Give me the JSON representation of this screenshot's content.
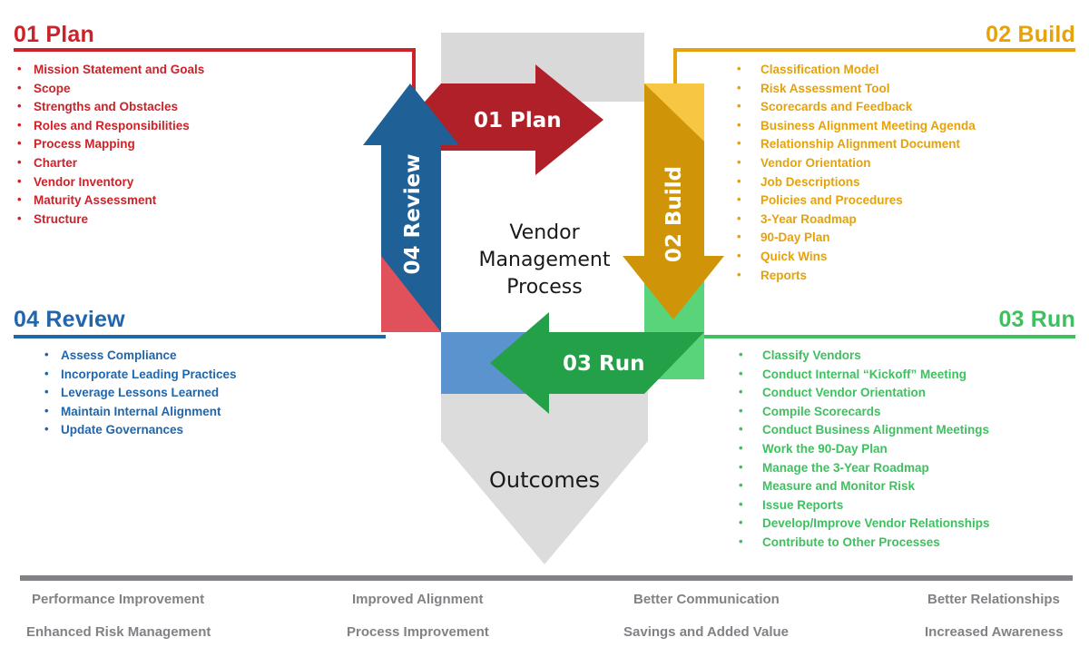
{
  "diagram": {
    "center": {
      "main_label": "Vendor\nManagement\nProcess",
      "main_label_line1": "Vendor",
      "main_label_line2": "Management",
      "main_label_line3": "Process",
      "outcomes_label": "Outcomes"
    },
    "arrows": [
      {
        "id": "plan",
        "label": "01 Plan",
        "direction": "right",
        "color": "#b02028",
        "accent": "#e0515b"
      },
      {
        "id": "build",
        "label": "02 Build",
        "direction": "down",
        "color": "#cf9408",
        "accent": "#f7c643"
      },
      {
        "id": "run",
        "label": "03 Run",
        "direction": "left",
        "color": "#24a148",
        "accent": "#5ad47a"
      },
      {
        "id": "review",
        "label": "04 Review",
        "direction": "up",
        "color": "#1f6096",
        "accent": "#5a93cd"
      }
    ]
  },
  "quadrants": [
    {
      "id": "plan",
      "title": "01 Plan",
      "color": "#cc2229",
      "items": [
        "Mission Statement and Goals",
        "Scope",
        "Strengths and Obstacles",
        "Roles and Responsibilities",
        "Process Mapping",
        "Charter",
        "Vendor Inventory",
        "Maturity Assessment",
        "Structure"
      ]
    },
    {
      "id": "build",
      "title": "02 Build",
      "color": "#e5a20a",
      "items": [
        "Classification Model",
        "Risk Assessment Tool",
        "Scorecards and Feedback",
        "Business Alignment Meeting Agenda",
        "Relationship Alignment Document",
        "Vendor Orientation",
        "Job Descriptions",
        "Policies and Procedures",
        "3-Year Roadmap",
        "90-Day Plan",
        "Quick Wins",
        "Reports"
      ]
    },
    {
      "id": "review",
      "title": "04 Review",
      "color": "#2166ab",
      "items": [
        "Assess Compliance",
        "Incorporate Leading Practices",
        "Leverage Lessons Learned",
        "Maintain Internal Alignment",
        "Update Governances"
      ]
    },
    {
      "id": "run",
      "title": "03 Run",
      "color": "#3fc060",
      "items": [
        "Classify Vendors",
        "Conduct Internal “Kickoff” Meeting",
        "Conduct Vendor Orientation",
        "Compile Scorecards",
        "Conduct Business Alignment Meetings",
        "Work the 90-Day Plan",
        "Manage the 3-Year Roadmap",
        "Measure and Monitor Risk",
        "Issue Reports",
        "Develop/Improve Vendor Relationships",
        "Contribute to Other Processes"
      ]
    }
  ],
  "outcomes": {
    "color": "#808285",
    "columns": [
      {
        "row1": "Performance Improvement",
        "row2": "Enhanced Risk Management"
      },
      {
        "row1": "Improved Alignment",
        "row2": "Process Improvement"
      },
      {
        "row1": "Better Communication",
        "row2": "Savings and Added Value"
      },
      {
        "row1": "Better Relationships",
        "row2": "Increased Awareness"
      }
    ]
  }
}
